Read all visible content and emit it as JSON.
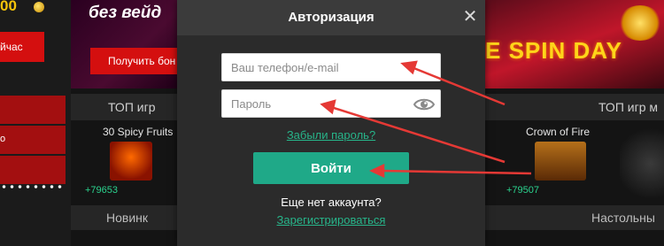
{
  "background": {
    "balance_fragment": "00",
    "now_button_fragment": "йчас",
    "sidebar_item_fragment": "о",
    "banner_left_text": "без вейд",
    "banner_left_button": "Получить бон",
    "banner_right_text": "E SPIN DAY",
    "top_games_left": "ТОП игр",
    "top_games_right": "ТОП игр м",
    "game_left_name": "30 Spicy Fruits",
    "game_left_count": "+79653",
    "game_right_name": "Crown of Fire",
    "game_right_count": "+79507",
    "new_left": "Новинк",
    "new_right": "Настольны"
  },
  "modal": {
    "title": "Авторизация",
    "login_placeholder": "Ваш телефон/e-mail",
    "password_placeholder": "Пароль",
    "forgot_password": "Забыли пароль?",
    "login_button": "Войти",
    "no_account": "Еще нет аккаунта?",
    "register": "Зарегистрироваться"
  },
  "colors": {
    "accent_green": "#1fa988",
    "link_green": "#27b58a",
    "annotation_red": "#e53935"
  },
  "icons": [
    "close-icon",
    "eye-icon",
    "coin-icon"
  ]
}
